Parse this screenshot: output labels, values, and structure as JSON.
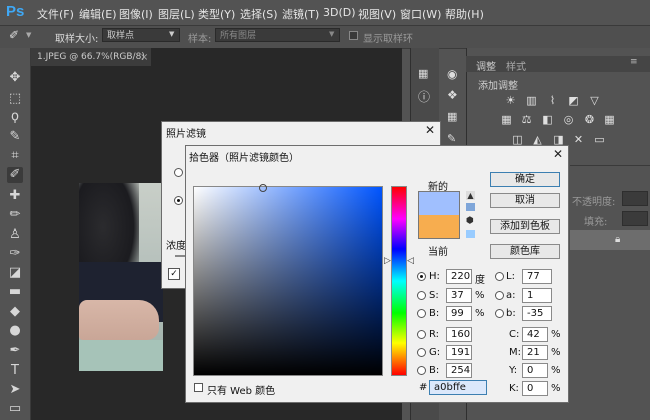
{
  "app": {
    "logo": "Ps"
  },
  "menu": [
    "文件(F)",
    "编辑(E)",
    "图像(I)",
    "图层(L)",
    "类型(Y)",
    "选择(S)",
    "滤镜(T)",
    "3D(D)",
    "视图(V)",
    "窗口(W)",
    "帮助(H)"
  ],
  "options_bar": {
    "sample_size_label": "取样大小:",
    "sample_size_value": "取样点",
    "sample_label": "样本:",
    "sample_value": "所有图层",
    "show_ring_label": "显示取样环"
  },
  "document": {
    "tab_title": "1.JPEG @ 66.7%(RGB/8)",
    "close": "×"
  },
  "panel": {
    "tabs": [
      "调整",
      "样式"
    ],
    "add_adjustment": "添加调整",
    "opacity_label": "不透明度:",
    "fill_label": "填充:"
  },
  "photo_filter": {
    "title": "照片滤镜",
    "density_label": "浓度",
    "preview_checkbox_glyph": "✓"
  },
  "color_picker": {
    "title": "拾色器（照片滤镜颜色）",
    "new_label": "新的",
    "current_label": "当前",
    "new_color": "#a0bffe",
    "current_color": "#f7ad4f",
    "buttons": {
      "ok": "确定",
      "cancel": "取消",
      "add_to_swatches": "添加到色板",
      "color_libraries": "颜色库"
    },
    "hsb": [
      {
        "label": "H:",
        "value": "220",
        "unit": "度"
      },
      {
        "label": "S:",
        "value": "37",
        "unit": "%"
      },
      {
        "label": "B:",
        "value": "99",
        "unit": "%"
      }
    ],
    "rgb": [
      {
        "label": "R:",
        "value": "160"
      },
      {
        "label": "G:",
        "value": "191"
      },
      {
        "label": "B:",
        "value": "254"
      }
    ],
    "lab": [
      {
        "label": "L:",
        "value": "77"
      },
      {
        "label": "a:",
        "value": "1"
      },
      {
        "label": "b:",
        "value": "-35"
      }
    ],
    "cmyk": [
      {
        "label": "C:",
        "value": "42",
        "unit": "%"
      },
      {
        "label": "M:",
        "value": "21",
        "unit": "%"
      },
      {
        "label": "Y:",
        "value": "0",
        "unit": "%"
      },
      {
        "label": "K:",
        "value": "0",
        "unit": "%"
      }
    ],
    "web_only_label": "只有 Web 颜色",
    "hex_label": "#",
    "hex_value": "a0bffe",
    "close": "×"
  }
}
